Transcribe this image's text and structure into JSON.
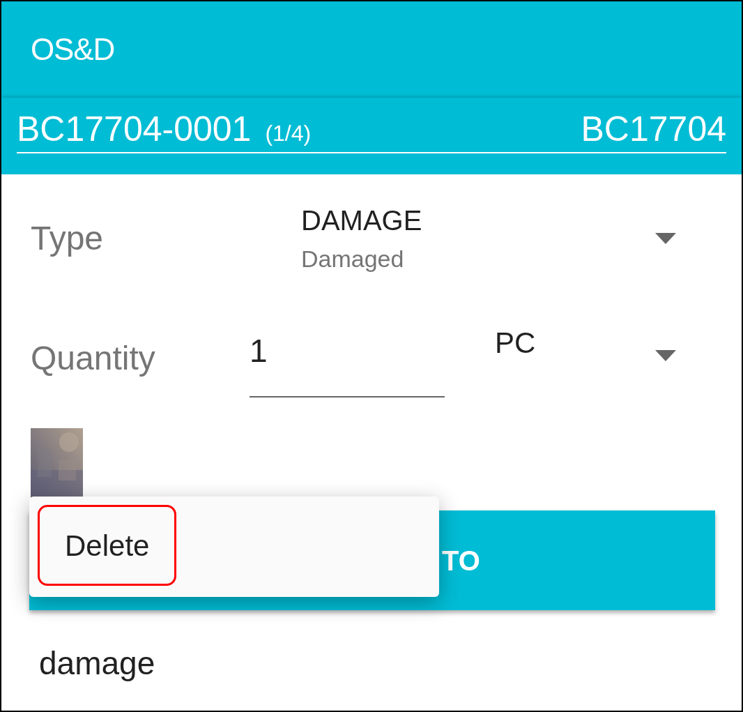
{
  "app_bar": {
    "title": "OS&D"
  },
  "record_bar": {
    "id": "BC17704-0001",
    "position": "(1/4)",
    "reference": "BC17704"
  },
  "type_field": {
    "label": "Type",
    "value": "DAMAGE",
    "description": "Damaged"
  },
  "quantity_field": {
    "label": "Quantity",
    "value": "1",
    "unit": "PC"
  },
  "photo_button": {
    "label": "TO"
  },
  "context_menu": {
    "items": [
      {
        "label": "Delete",
        "selected": true
      }
    ]
  },
  "note": "damage"
}
